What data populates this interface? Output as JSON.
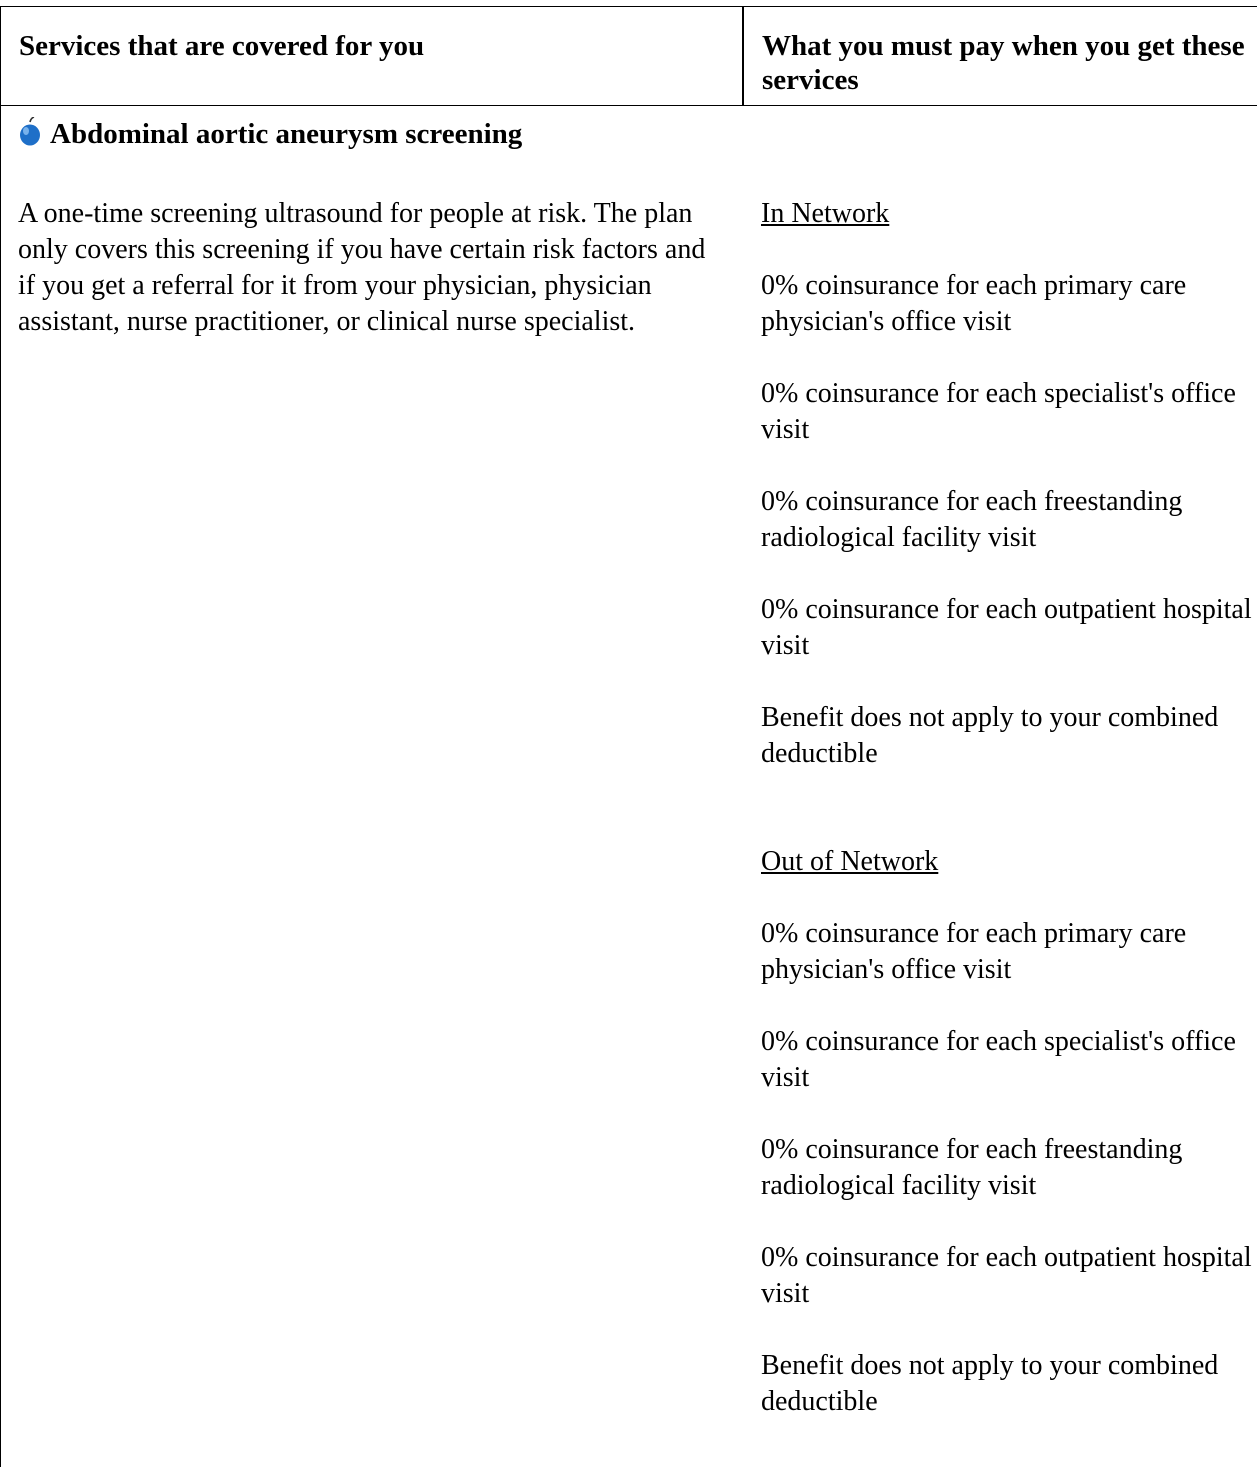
{
  "header": {
    "left": "Services that are covered for you",
    "right": "What you must pay when you get these services"
  },
  "service": {
    "icon": "apple-icon",
    "title": "Abdominal aortic aneurysm screening",
    "description": "A one-time screening ultrasound for people at risk. The plan only covers this screening if you have certain risk factors and if you get a referral for it from your physician, physician assistant, nurse practitioner, or clinical nurse specialist."
  },
  "payments": {
    "in_network": {
      "heading": "In Network",
      "items": [
        "0% coinsurance for each primary care physician's office visit",
        "0% coinsurance for each specialist's office visit",
        "0% coinsurance for each freestanding radiological facility visit",
        "0% coinsurance for each outpatient hospital visit",
        "Benefit does not apply to your combined deductible"
      ]
    },
    "out_network": {
      "heading": "Out of Network",
      "items": [
        "0% coinsurance for each primary care physician's office visit",
        "0% coinsurance for each specialist's office visit",
        "0% coinsurance for each freestanding radiological facility visit",
        "0% coinsurance for each outpatient hospital visit",
        "Benefit does not apply to your combined deductible"
      ]
    }
  },
  "colors": {
    "apple_icon": "#1e6fc8",
    "border": "#000000"
  }
}
